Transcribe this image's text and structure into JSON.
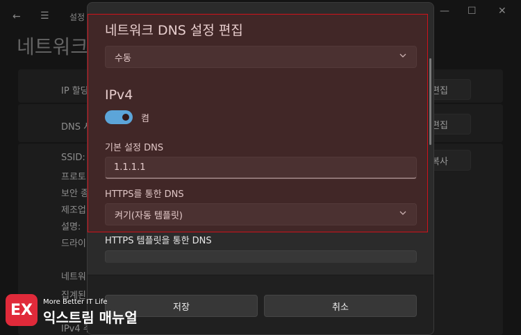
{
  "background": {
    "breadcrumb": "설정",
    "heading": "네트워크",
    "rows": [
      {
        "label": "IP 할당",
        "button": "편집"
      },
      {
        "label": "DNS 서",
        "button": "편집"
      }
    ],
    "details": [
      "SSID:",
      "프로토",
      "보안 종",
      "제조업",
      "설명:",
      "드라이"
    ],
    "copy_button": "복사",
    "more": [
      "네트워",
      "집계된",
      "IPv4 주"
    ]
  },
  "dialog": {
    "title": "네트워크 DNS 설정 편집",
    "mode_select": "수동",
    "section": "IPv4",
    "toggle_label": "켬",
    "toggle_on": true,
    "preferred_dns_label": "기본 설정 DNS",
    "preferred_dns_value": "1.1.1.1",
    "https_label": "HTTPS를 통한 DNS",
    "https_value": "켜기(자동 템플릿)",
    "template_label": "HTTPS 템플릿을 통한 DNS",
    "save_button": "저장",
    "cancel_button": "취소"
  },
  "watermark": {
    "badge": "EX",
    "tagline": "More Better IT Life",
    "brand": "익스트림 매뉴얼"
  },
  "colors": {
    "accent": "#4cc2ff",
    "highlight_border": "#d0121b",
    "badge": "#e02a3a"
  }
}
